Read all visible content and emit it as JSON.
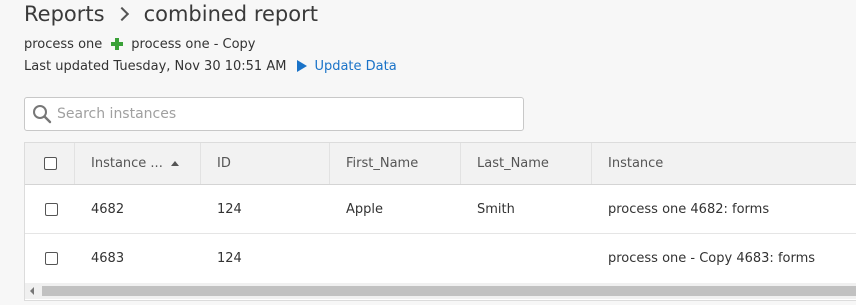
{
  "breadcrumb": {
    "parent": "Reports",
    "current": "combined report"
  },
  "sources": {
    "first": "process one",
    "second": "process one - Copy"
  },
  "status": {
    "last_updated": "Last updated Tuesday, Nov 30 10:51 AM",
    "update_label": "Update Data"
  },
  "search": {
    "placeholder": "Search instances",
    "value": ""
  },
  "table": {
    "columns": [
      "Instance ...",
      "ID",
      "First_Name",
      "Last_Name",
      "Instance"
    ],
    "sort": {
      "column": "Instance ...",
      "direction": "ascending"
    },
    "rows": [
      {
        "instance_id": "4682",
        "id": "124",
        "first_name": "Apple",
        "last_name": "Smith",
        "instance": "process one 4682: forms"
      },
      {
        "instance_id": "4683",
        "id": "124",
        "first_name": "",
        "last_name": "",
        "instance": "process one - Copy 4683: forms"
      }
    ]
  },
  "colors": {
    "accent": "#1a73c8",
    "add": "#3aa138"
  }
}
